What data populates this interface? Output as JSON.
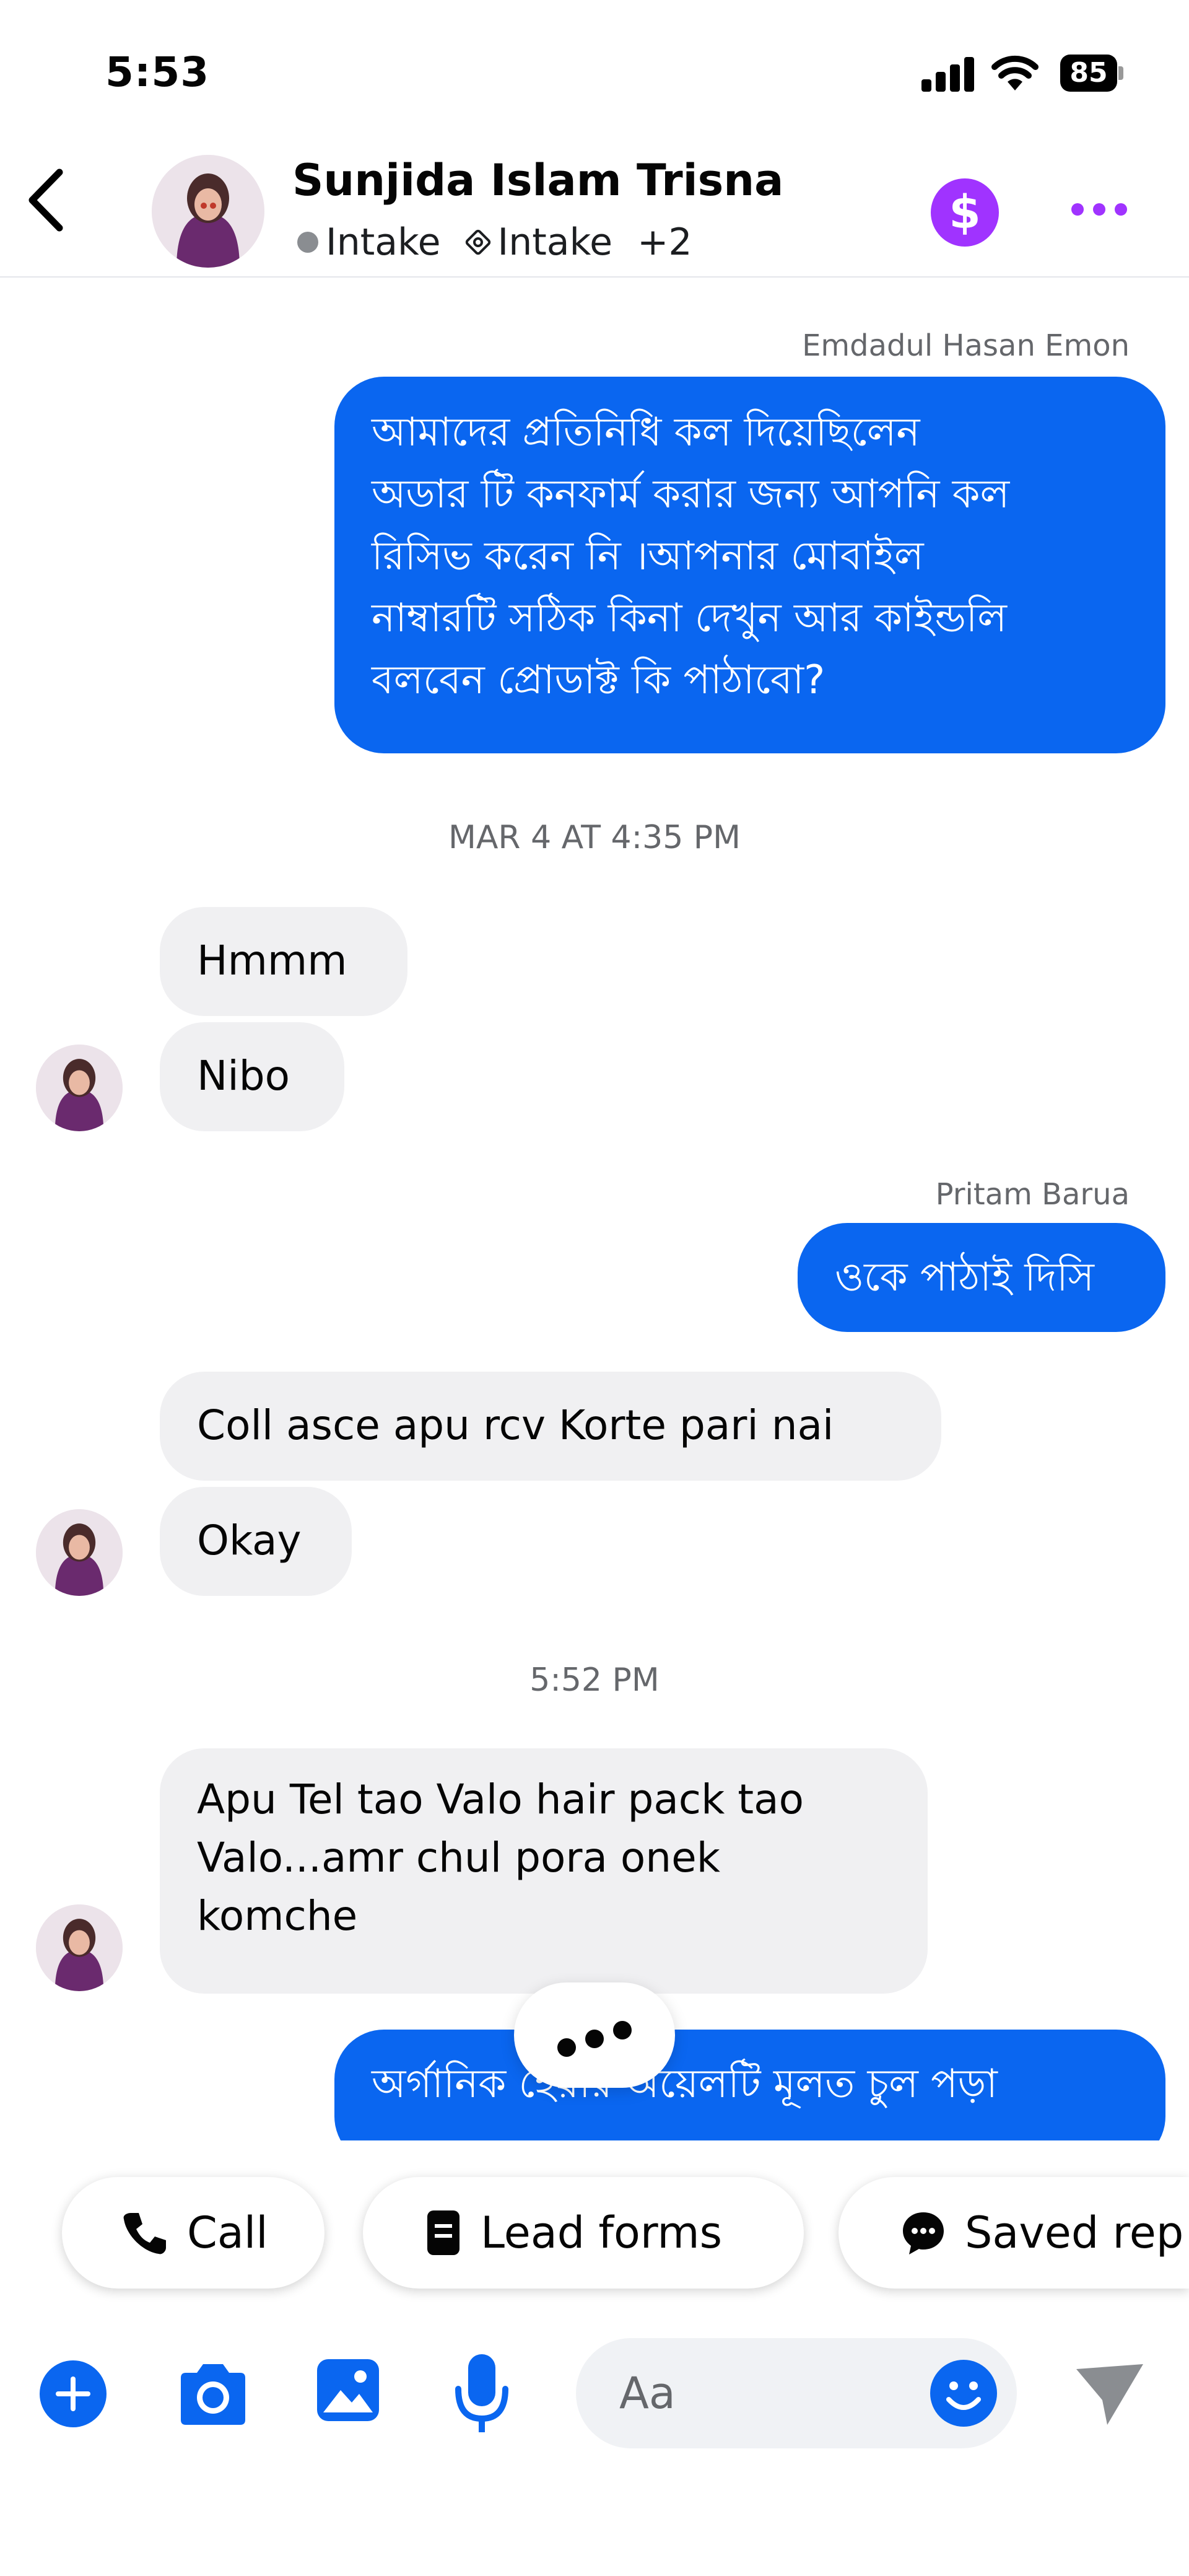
{
  "status_bar": {
    "time": "5:53",
    "battery": "85"
  },
  "header": {
    "name": "Sunjida Islam Trisna",
    "tags": [
      "Intake",
      "Intake",
      "+2"
    ],
    "colors": {
      "accent": "#a033ff"
    }
  },
  "messages": [
    {
      "type": "sender",
      "text": "Emdadul Hasan Emon"
    },
    {
      "type": "outgoing",
      "text": "আমাদের প্রতিনিধি কল দিয়েছিলেন\nঅডার টি কনফার্ম করার জন্য আপনি কল\nরিসিভ করেন নি ।আপনার মোবাইল\nনাম্বারটি সঠিক কিনা দেখুন আর কাইন্ডলি\nবলবেন প্রোডাক্ট কি পাঠাবো?"
    },
    {
      "type": "timestamp",
      "text": "MAR 4 AT 4:35 PM"
    },
    {
      "type": "incoming",
      "text": "Hmmm"
    },
    {
      "type": "incoming",
      "text": "Nibo"
    },
    {
      "type": "sender",
      "text": "Pritam Barua"
    },
    {
      "type": "outgoing",
      "text": "ওকে পাঠাই দিসি"
    },
    {
      "type": "incoming",
      "text": "Coll asce apu rcv Korte pari nai"
    },
    {
      "type": "incoming",
      "text": "Okay"
    },
    {
      "type": "timestamp",
      "text": "5:52 PM"
    },
    {
      "type": "incoming",
      "text": "Apu Tel tao Valo hair pack tao\nValo...amr chul pora onek\nkomche"
    },
    {
      "type": "outgoing_partial",
      "text": "অর্গানিক হেয়ার অয়েলটি মূলত চুল পড়া"
    }
  ],
  "quick_actions": [
    {
      "label": "Call",
      "icon": "phone-icon"
    },
    {
      "label": "Lead forms",
      "icon": "document-icon"
    },
    {
      "label": "Saved rep",
      "icon": "chat-bubble-icon"
    }
  ],
  "composer": {
    "placeholder": "Aa",
    "icons": [
      "plus-icon",
      "camera-icon",
      "image-icon",
      "microphone-icon",
      "emoji-icon",
      "send-icon"
    ],
    "accent": "#0a66f0"
  }
}
